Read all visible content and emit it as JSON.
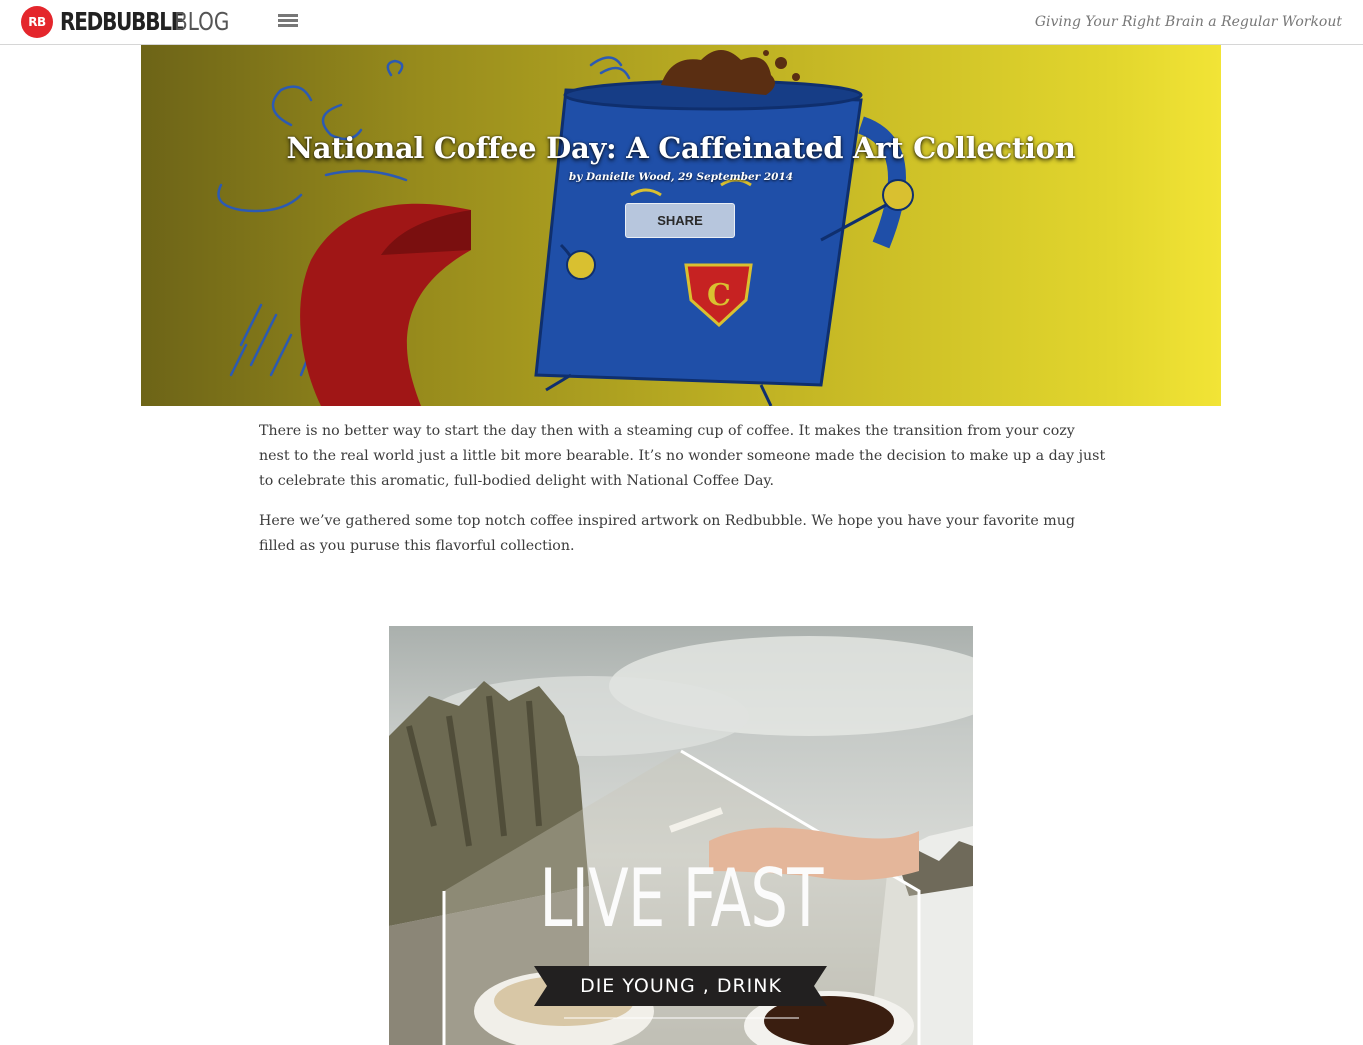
{
  "header": {
    "logo_badge": "RB",
    "logo_word": "REDBUBBLE",
    "logo_suffix": "BLOG",
    "tagline": "Giving Your Right Brain a Regular Workout",
    "menu_icon": "hamburger-menu-icon"
  },
  "hero": {
    "title": "National Coffee Day: A Caffeinated Art Collection",
    "byline": "by Danielle Wood, 29 September 2014",
    "share_label": "SHARE",
    "illustration_badge_letter": "C"
  },
  "article": {
    "paragraphs": [
      "There is no better way to start the day then with a steaming cup of coffee. It makes the transition from your cozy nest to the real world just a little bit more bearable. It’s no wonder someone made the decision to make up a day just to celebrate this aromatic, full-bodied delight with National Coffee Day.",
      "Here we’ve gathered some top notch coffee inspired artwork on Redbubble. We hope you have your favorite mug filled as you puruse this flavorful collection."
    ]
  },
  "artwork": {
    "headline": "LIVE FAST",
    "ribbon": "DIE YOUNG , DRINK"
  },
  "colors": {
    "brand_red": "#e4262c",
    "hero_yellow": "#e2d62d",
    "mug_blue": "#1f4fa8",
    "cape_red": "#a01616"
  }
}
